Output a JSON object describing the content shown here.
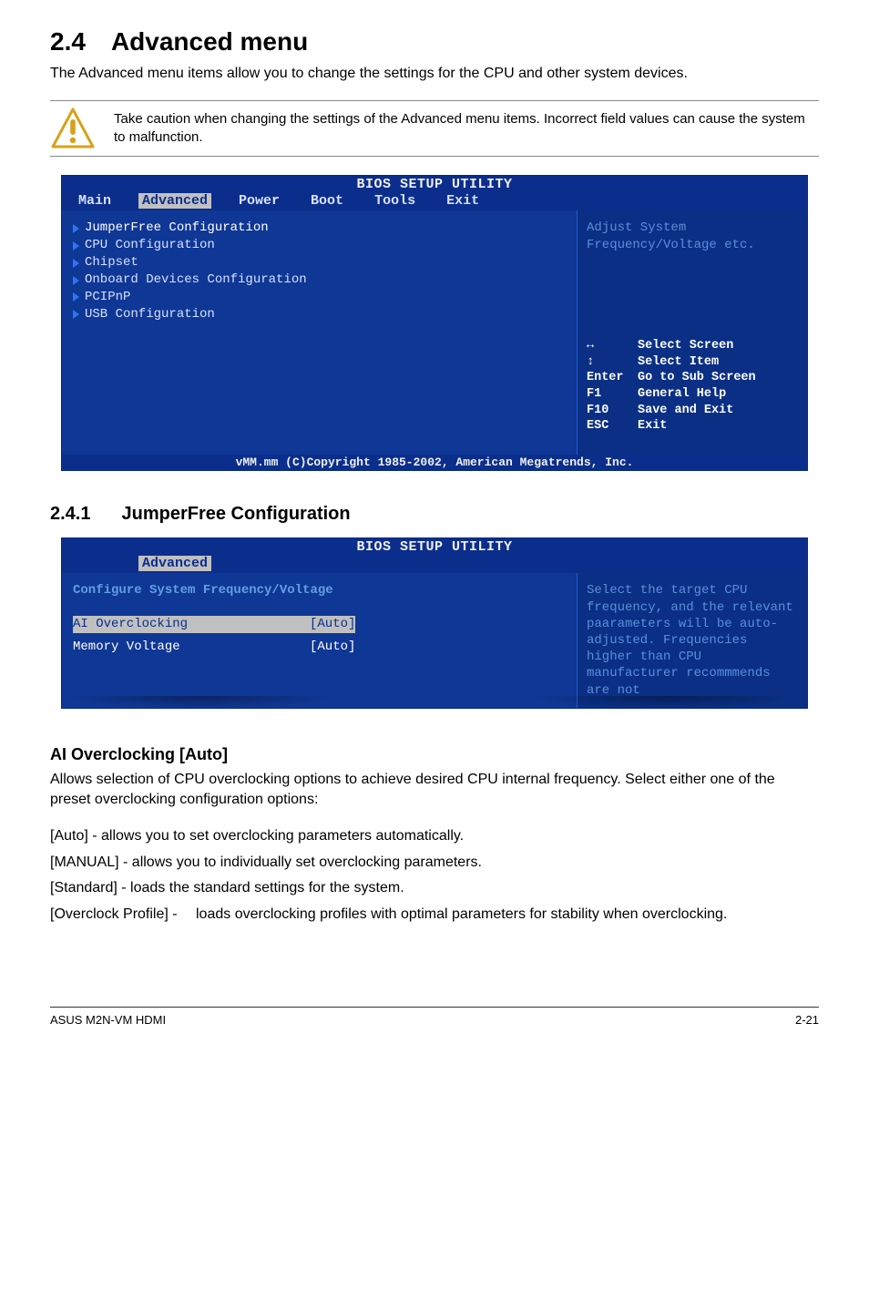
{
  "page": {
    "h1_num": "2.4",
    "h1_title": "Advanced menu",
    "intro": "The Advanced menu items allow you to change the settings for the CPU and other system devices.",
    "caution": "Take caution when changing the settings of the Advanced menu items. Incorrect field values can cause the system to malfunction."
  },
  "bios1": {
    "title": "BIOS SETUP UTILITY",
    "tabs": [
      "Main",
      "Advanced",
      "Power",
      "Boot",
      "Tools",
      "Exit"
    ],
    "items": [
      "JumperFree Configuration",
      "CPU Configuration",
      "Chipset",
      "Onboard Devices Configuration",
      "PCIPnP",
      "USB Configuration"
    ],
    "help1": "Adjust System",
    "help2": "Frequency/Voltage etc.",
    "nav": {
      "sel_screen": "Select Screen",
      "sel_item": "Select Item",
      "enter": "Go to Sub Screen",
      "f1": "General Help",
      "f10": "Save and Exit",
      "esc": "Exit"
    },
    "foot": "vMM.mm (C)Copyright 1985-2002, American Megatrends, Inc."
  },
  "sec241": {
    "num": "2.4.1",
    "title": "JumperFree Configuration"
  },
  "bios2": {
    "title": "BIOS SETUP UTILITY",
    "tab": "Advanced",
    "heading": "Configure System Frequency/Voltage",
    "rows": [
      {
        "label": "AI Overclocking",
        "value": "[Auto]"
      },
      {
        "label": "Memory Voltage",
        "value": "[Auto]"
      }
    ],
    "help": "Select the target CPU frequency, and the relevant paarameters will be auto-adjusted. Frequencies higher than CPU manufacturer recommmends are not"
  },
  "ai": {
    "heading": "AI Overclocking [Auto]",
    "desc": "Allows selection of CPU overclocking options to achieve desired CPU internal frequency. Select either one of the preset overclocking configuration options:",
    "auto": "[Auto] - allows you to set overclocking parameters automatically.",
    "manual": "[MANUAL] - allows you to individually set overclocking parameters.",
    "standard": "[Standard] - loads the standard settings for the system.",
    "over_tag": "[Overclock Profile] - ",
    "over_body": "loads overclocking profiles with optimal parameters for stability when overclocking."
  },
  "footer": {
    "left": "ASUS M2N-VM HDMI",
    "right": "2-21"
  }
}
